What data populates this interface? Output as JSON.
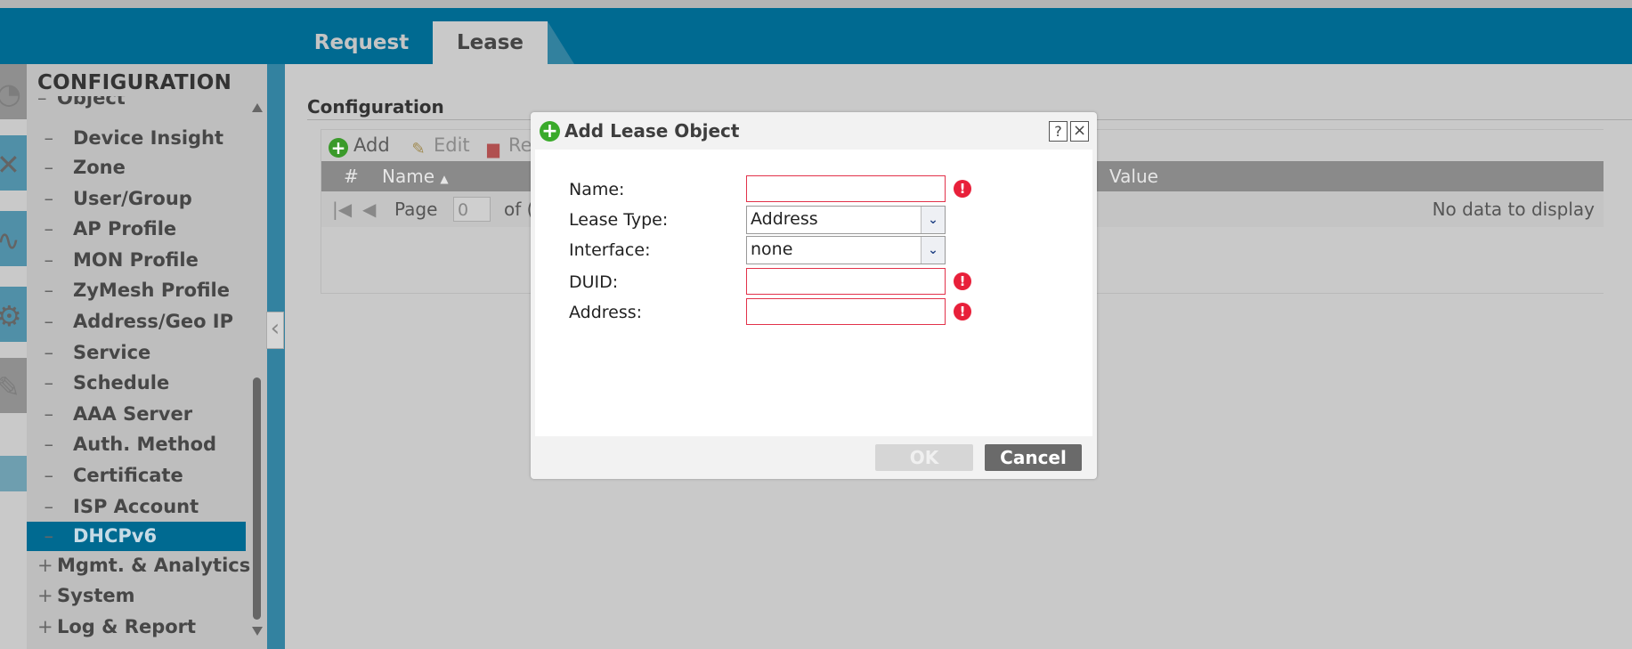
{
  "tabs": [
    {
      "label": "Request",
      "active": false
    },
    {
      "label": "Lease",
      "active": true
    }
  ],
  "sidebar": {
    "title": "CONFIGURATION",
    "items": [
      {
        "label": "Object",
        "kind": "parent",
        "expanded": true
      },
      {
        "label": "Device Insight"
      },
      {
        "label": "Zone"
      },
      {
        "label": "User/Group"
      },
      {
        "label": "AP Profile"
      },
      {
        "label": "MON Profile"
      },
      {
        "label": "ZyMesh Profile"
      },
      {
        "label": "Address/Geo IP"
      },
      {
        "label": "Service"
      },
      {
        "label": "Schedule"
      },
      {
        "label": "AAA Server"
      },
      {
        "label": "Auth. Method"
      },
      {
        "label": "Certificate"
      },
      {
        "label": "ISP Account"
      },
      {
        "label": "DHCPv6",
        "selected": true
      },
      {
        "label": "Mgmt. & Analytics",
        "kind": "parent"
      },
      {
        "label": "System",
        "kind": "parent"
      },
      {
        "label": "Log & Report",
        "kind": "parent"
      }
    ]
  },
  "main": {
    "section_title": "Configuration",
    "toolbar": {
      "add": "Add",
      "edit": "Edit",
      "remove": "Re"
    },
    "columns": {
      "hash": "#",
      "name": "Name",
      "value": "Value"
    },
    "pager": {
      "page_label": "Page",
      "page_value": "0",
      "of_label": "of (",
      "empty": "No data to display"
    }
  },
  "dialog": {
    "title": "Add Lease Object",
    "help": "?",
    "close": "×",
    "fields": {
      "name_label": "Name:",
      "name_value": "",
      "lease_type_label": "Lease Type:",
      "lease_type_value": "Address",
      "interface_label": "Interface:",
      "interface_value": "none",
      "duid_label": "DUID:",
      "duid_value": "",
      "address_label": "Address:",
      "address_value": ""
    },
    "ok": "OK",
    "cancel": "Cancel"
  },
  "colors": {
    "brand": "#006a91",
    "error": "#e8203a",
    "add_green": "#3aaa2a"
  }
}
